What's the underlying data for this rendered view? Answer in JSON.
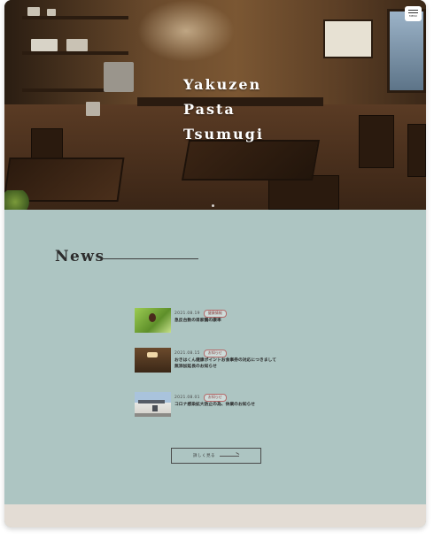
{
  "hero": {
    "title_lines": [
      "Yakuzen",
      "Pasta",
      "Tsumugi"
    ],
    "menu_label": "MENU"
  },
  "news": {
    "heading": "News",
    "items": [
      {
        "date": "2021.08.19",
        "badge": "健康情報",
        "title_lines": [
          "急反台数の目家鶴の康率",
          ""
        ],
        "thumb": "green-leaf"
      },
      {
        "date": "2021.08.15",
        "badge": "お知らせ",
        "title_lines": [
          "おきはくん健康ポイントお食事券の対応につきまして",
          "無添加延長のお知らせ"
        ],
        "thumb": "restaurant-interior"
      },
      {
        "date": "2021.08.01",
        "badge": "お知らせ",
        "title_lines": [
          "コロナ感染拡大防止の為、休業のお知らせ",
          ""
        ],
        "thumb": "building-exterior"
      }
    ],
    "more_label": "詳しく見る"
  },
  "colors": {
    "news_bg": "#adc5c2",
    "footer_bg": "#e3dcd4",
    "badge_color": "#8a3a3a"
  }
}
